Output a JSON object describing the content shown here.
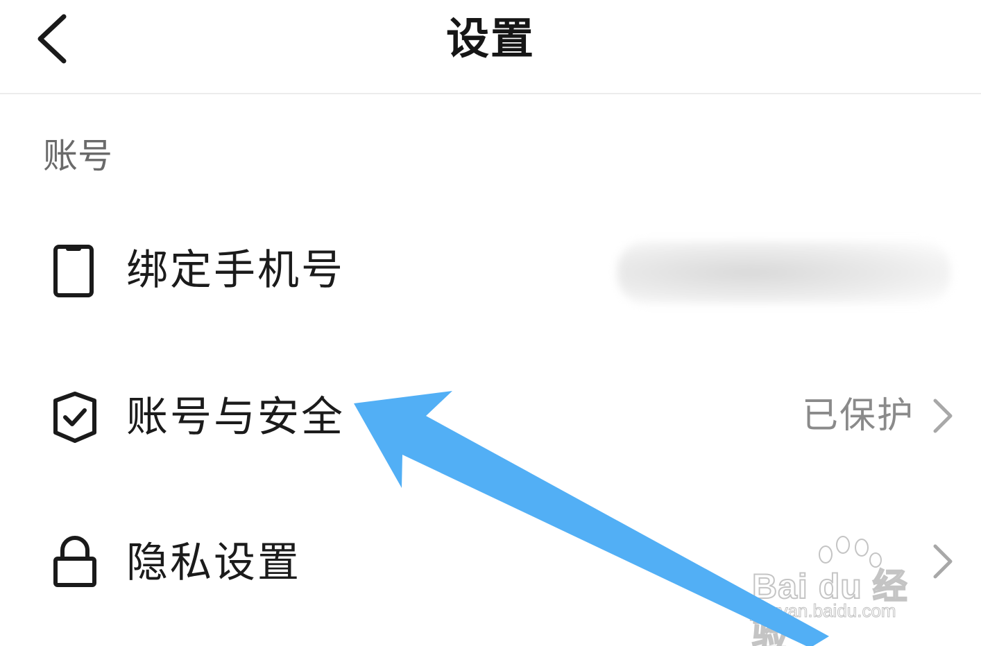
{
  "header": {
    "title": "设置",
    "back_icon": "chevron-left-icon"
  },
  "section": {
    "title": "账号"
  },
  "rows": [
    {
      "label": "绑定手机号",
      "icon": "phone-icon",
      "value": "",
      "value_blurred": true,
      "chevron": false
    },
    {
      "label": "账号与安全",
      "icon": "shield-check-icon",
      "value": "已保护",
      "chevron": true
    },
    {
      "label": "隐私设置",
      "icon": "lock-icon",
      "value": "",
      "chevron": true
    }
  ],
  "colors": {
    "title": "#161616",
    "label": "#1b1b1b",
    "section": "#6a6a6a",
    "value": "#8a8a8a",
    "chevron": "#a8a8a8",
    "annotation_arrow": "#52aff5",
    "divider": "#ececec"
  },
  "watermark": {
    "logo": "Bai du 经验",
    "url": "jingyan.baidu.com"
  }
}
